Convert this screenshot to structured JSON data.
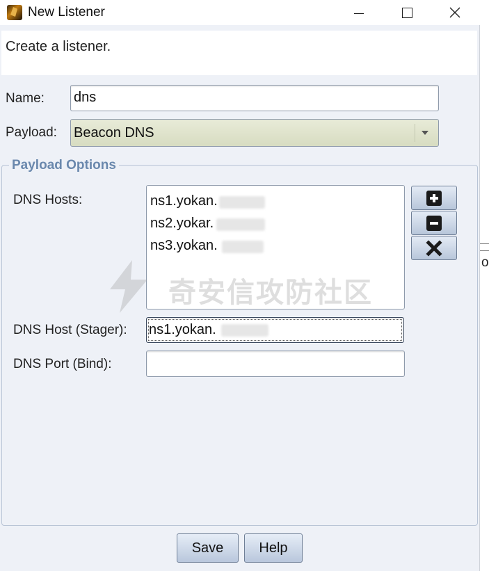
{
  "window": {
    "title": "New Listener",
    "description": "Create a listener."
  },
  "form": {
    "name_label": "Name:",
    "name_value": "dns",
    "payload_label": "Payload:",
    "payload_value": "Beacon DNS"
  },
  "payload_options": {
    "group_title": "Payload Options",
    "dns_hosts_label": "DNS Hosts:",
    "dns_hosts": [
      "ns1.yokan.",
      "ns2.yokar.",
      "ns3.yokan."
    ],
    "dns_host_stager_label": "DNS Host (Stager):",
    "dns_host_stager_value": "ns1.yokan.",
    "dns_port_label": "DNS Port (Bind):",
    "dns_port_value": ""
  },
  "buttons": {
    "save": "Save",
    "help": "Help"
  },
  "watermark": {
    "text": "奇安信攻防社区"
  },
  "background_window": {
    "edge_text": "o"
  },
  "icons": {
    "add": "plus-icon",
    "remove": "minus-icon",
    "clear": "x-icon"
  }
}
